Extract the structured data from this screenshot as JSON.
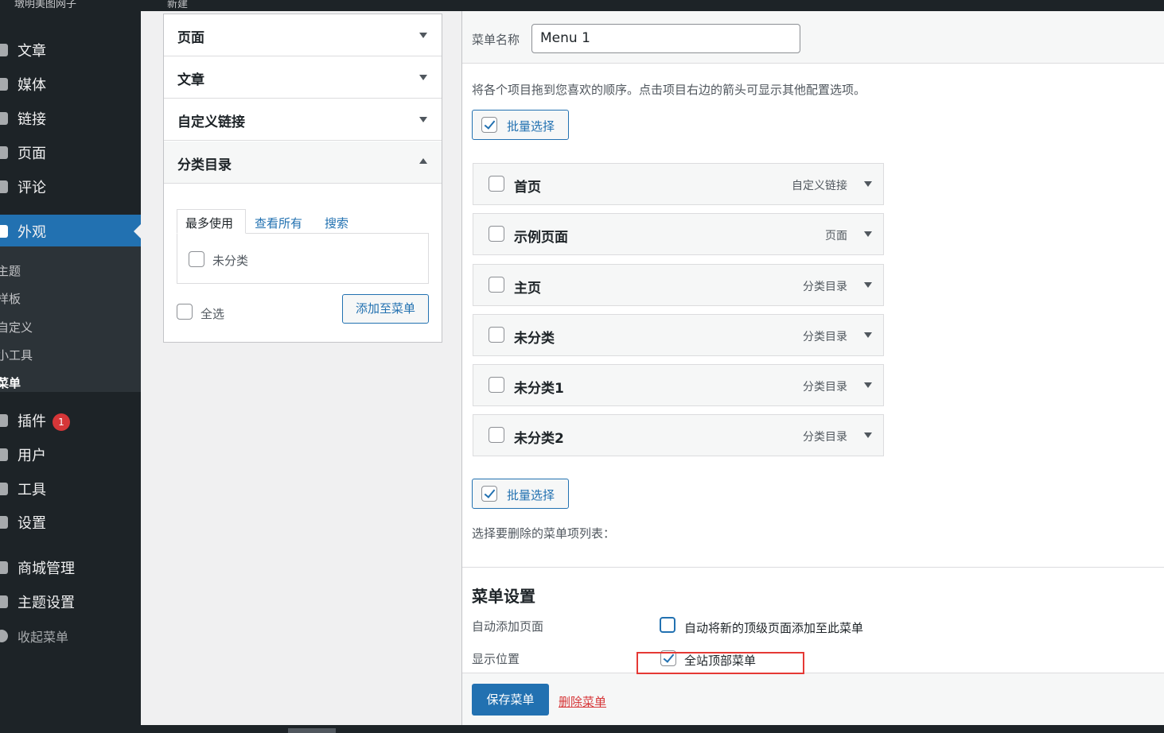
{
  "adminbar": {
    "site": "墩明美图网子",
    "new": "新建"
  },
  "sidebar": {
    "items": [
      {
        "label": "文章"
      },
      {
        "label": "媒体"
      },
      {
        "label": "链接"
      },
      {
        "label": "页面"
      },
      {
        "label": "评论"
      },
      {
        "label": "外观"
      },
      {
        "label": "插件",
        "badge": "1"
      },
      {
        "label": "用户"
      },
      {
        "label": "工具"
      },
      {
        "label": "设置"
      },
      {
        "label": "商城管理"
      },
      {
        "label": "主题设置"
      },
      {
        "label": "收起菜单"
      }
    ],
    "submenu": [
      "主题",
      "样板",
      "自定义",
      "小工具",
      "菜单"
    ]
  },
  "accordion": {
    "sections": [
      "页面",
      "文章",
      "自定义链接",
      "分类目录"
    ],
    "tabs": [
      "最多使用",
      "查看所有",
      "搜索"
    ],
    "category_item": "未分类",
    "select_all": "全选",
    "add_button": "添加至菜单"
  },
  "main": {
    "menu_name_label": "菜单名称",
    "menu_name_value": "Menu 1",
    "instructions": "将各个项目拖到您喜欢的顺序。点击项目右边的箭头可显示其他配置选项。",
    "bulk_select": "批量选择",
    "items": [
      {
        "name": "首页",
        "type": "自定义链接"
      },
      {
        "name": "示例页面",
        "type": "页面"
      },
      {
        "name": "主页",
        "type": "分类目录"
      },
      {
        "name": "未分类",
        "type": "分类目录"
      },
      {
        "name": "未分类1",
        "type": "分类目录"
      },
      {
        "name": "未分类2",
        "type": "分类目录"
      }
    ],
    "delete_list_label": "选择要删除的菜单项列表：",
    "settings_title": "菜单设置",
    "auto_add_label": "自动添加页面",
    "auto_add_option": "自动将新的顶级页面添加至此菜单",
    "display_location_label": "显示位置",
    "display_location_option": "全站顶部菜单",
    "save_button": "保存菜单",
    "delete_menu": "删除菜单"
  }
}
